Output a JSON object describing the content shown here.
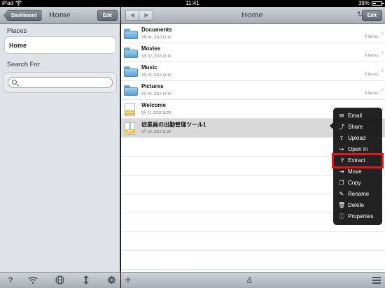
{
  "status_bar": {
    "carrier": "iPad",
    "time": "11:41",
    "battery": "39%",
    "battery_level": 0.39
  },
  "left_pane": {
    "back_label": "Dashboard",
    "title": "Home",
    "edit_label": "Edit",
    "places_label": "Places",
    "places_item": "Home",
    "search_label": "Search For",
    "search_value": "",
    "bottom_icons": [
      "help-icon",
      "wifi-icon",
      "globe-icon",
      "sort-icon",
      "gear-icon"
    ],
    "help_glyph": "?"
  },
  "right_pane": {
    "title": "Home",
    "edit_label": "Edit",
    "prev_glyph": "◀",
    "next_glyph": "▶",
    "refresh_glyph": "↻",
    "files": [
      {
        "name": "Documents",
        "date": "3月 02, 2013 13:16",
        "items": "0 items",
        "type": "folder"
      },
      {
        "name": "Movies",
        "date": "3月 02, 2013 13:16",
        "items": "0 items",
        "type": "folder"
      },
      {
        "name": "Music",
        "date": "3月 02, 2013 13:16",
        "items": "0 items",
        "type": "folder"
      },
      {
        "name": "Pictures",
        "date": "3月 02, 2013 13:16",
        "items": "0 items",
        "type": "folder"
      },
      {
        "name": "Welcome",
        "date": "2月 11, 2013 16:20",
        "items": "",
        "type": "webarchive",
        "badge": "WEBA"
      },
      {
        "name": "従業員の出勤管理ツール1",
        "date": "3月 03, 2013 11:38",
        "items": "",
        "type": "zip",
        "badge": "ZIP"
      }
    ],
    "plus_glyph": "+",
    "textsize_glyph": "A"
  },
  "context_menu": {
    "items": [
      {
        "label": "Email",
        "icon": "envelope-icon",
        "glyph": "✉"
      },
      {
        "label": "Share",
        "icon": "share-icon",
        "glyph": "⤴"
      },
      {
        "label": "Upload",
        "icon": "upload-icon",
        "glyph": "⇪"
      },
      {
        "label": "Open In",
        "icon": "open-in-icon",
        "glyph": "↪"
      },
      {
        "label": "Extract",
        "icon": "extract-icon",
        "glyph": "Y"
      },
      {
        "label": "Move",
        "icon": "move-icon",
        "glyph": "⇥"
      },
      {
        "label": "Copy",
        "icon": "copy-icon",
        "glyph": "❐"
      },
      {
        "label": "Rename",
        "icon": "rename-icon",
        "glyph": "✎"
      },
      {
        "label": "Delete",
        "icon": "trash-icon",
        "glyph": "🗑"
      },
      {
        "label": "Properties",
        "icon": "info-icon",
        "glyph": "ⓘ"
      }
    ],
    "highlighted": "Extract",
    "highlight_color": "#e01818"
  },
  "colors": {
    "toolbar": "#a8aeb6",
    "sidebar_bg": "#dfe2e6",
    "menu_bg": "#141414"
  }
}
